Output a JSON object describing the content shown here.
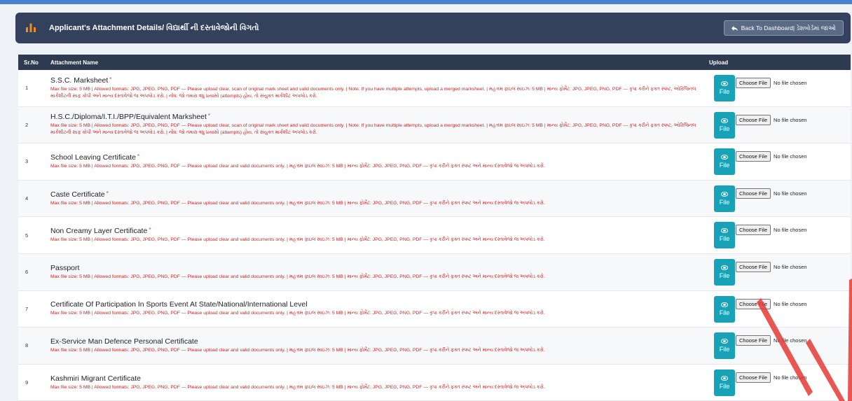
{
  "header": {
    "title": "Applicant's Attachment Details/ વિદ્યાર્થી ની દસ્તાવેજોની વિગતો",
    "back_label": "Back To Dashboard| ડેશબોર્ડમાં જાઓ"
  },
  "table": {
    "headers": {
      "sr": "Sr.No",
      "name": "Attachment Name",
      "upload": "Upload"
    },
    "file_button_label": "File",
    "choose_label": "Choose File",
    "no_file_label": "No file chosen",
    "rows": [
      {
        "sr": "1",
        "name": "S.S.C. Marksheet",
        "required": "*",
        "desc": "Max file size: 5 MB | Allowed formats: JPG, JPEG, PNG, PDF — Please upload clear, scan of original mark sheet and valid documents only. | Note: If you have multiple attempts, upload a merged marksheet. | મહત્તમ ફાઇલ સાઇઝ: 5 MB | માન્ય ફોર્મેટ: JPG, JPEG, PNG, PDF — કૃપા કરીને ફક્ત સ્પષ્ટ, ઓરિજિનલ માર્કશીટની સાફ કોપી અને માન્ય દસ્તાવેજો જ અપલોડ કરો. | નોંધ: જો તમારા વધુ પ્રયાસો (attempts) હોય, તો સંયુક્ત માર્કશીટ અપલોડ કરો."
      },
      {
        "sr": "2",
        "name": "H.S.C./Diploma/I.T.I./BPP/Equivalent Marksheet",
        "required": "*",
        "desc": "Max file size: 5 MB | Allowed formats: JPG, JPEG, PNG, PDF — Please upload clear, scan of original mark sheet and valid documents only. | Note: If you have multiple attempts, upload a merged marksheet. | મહત્તમ ફાઇલ સાઇઝ: 5 MB | માન્ય ફોર્મેટ: JPG, JPEG, PNG, PDF — કૃપા કરીને ફક્ત સ્પષ્ટ, ઓરિજિનલ માર્કશીટની સાફ કોપી અને માન્ય દસ્તાવેજો જ અપલોડ કરો. | નોંધ: જો તમારા વધુ પ્રયાસો (attempts) હોય, તો સંયુક્ત માર્કશીટ અપલોડ કરો."
      },
      {
        "sr": "3",
        "name": "School Leaving Certificate",
        "required": "*",
        "desc": "Max file size: 5 MB | Allowed formats: JPG, JPEG, PNG, PDF — Please upload clear and valid documents only. | મહત્તમ ફાઇલ સાઇઝ: 5 MB | માન્ય ફોર્મેટ: JPG, JPEG, PNG, PDF — કૃપા કરીને ફક્ત સ્પષ્ટ અને માન્ય દસ્તાવેજો જ અપલોડ કરો."
      },
      {
        "sr": "4",
        "name": "Caste Certificate",
        "required": "*",
        "desc": "Max file size: 5 MB | Allowed formats: JPG, JPEG, PNG, PDF — Please upload clear and valid documents only. | મહત્તમ ફાઇલ સાઇઝ: 5 MB | માન્ય ફોર્મેટ: JPG, JPEG, PNG, PDF — કૃપા કરીને ફક્ત સ્પષ્ટ અને માન્ય દસ્તાવેજો જ અપલોડ કરો."
      },
      {
        "sr": "5",
        "name": "Non Creamy Layer Certificate",
        "required": "*",
        "desc": "Max file size: 5 MB | Allowed formats: JPG, JPEG, PNG, PDF — Please upload clear and valid documents only. | મહત્તમ ફાઇલ સાઇઝ: 5 MB | માન્ય ફોર્મેટ: JPG, JPEG, PNG, PDF — કૃપા કરીને ફક્ત સ્પષ્ટ અને માન્ય દસ્તાવેજો જ અપલોડ કરો."
      },
      {
        "sr": "6",
        "name": "Passport",
        "required": "",
        "desc": "Max file size: 5 MB | Allowed formats: JPG, JPEG, PNG, PDF — Please upload clear and valid documents only. | મહત્તમ ફાઇલ સાઇઝ: 5 MB | માન્ય ફોર્મેટ: JPG, JPEG, PNG, PDF — કૃપા કરીને ફક્ત સ્પષ્ટ અને માન્ય દસ્તાવેજો જ અપલોડ કરો."
      },
      {
        "sr": "7",
        "name": "Certificate Of Participation In Sports Event At State/National/International Level",
        "required": "",
        "desc": "Max file size: 5 MB | Allowed formats: JPG, JPEG, PNG, PDF — Please upload clear and valid documents only. | મહત્તમ ફાઇલ સાઇઝ: 5 MB | માન્ય ફોર્મેટ: JPG, JPEG, PNG, PDF — કૃપા કરીને ફક્ત સ્પષ્ટ અને માન્ય દસ્તાવેજો જ અપલોડ કરો."
      },
      {
        "sr": "8",
        "name": "Ex-Service Man Defence Personal Certificate",
        "required": "",
        "desc": "Max file size: 5 MB | Allowed formats: JPG, JPEG, PNG, PDF — Please upload clear and valid documents only. | મહત્તમ ફાઇલ સાઇઝ: 5 MB | માન્ય ફોર્મેટ: JPG, JPEG, PNG, PDF — કૃપા કરીને ફક્ત સ્પષ્ટ અને માન્ય દસ્તાવેજો જ અપલોડ કરો."
      },
      {
        "sr": "9",
        "name": "Kashmiri Migrant Certificate",
        "required": "",
        "desc": "Max file size: 5 MB | Allowed formats: JPG, JPEG, PNG, PDF — Please upload clear and valid documents only. | મહત્તમ ફાઇલ સાઇઝ: 5 MB | માન્ય ફોર્મેટ: JPG, JPEG, PNG, PDF — કૃપા કરીને ફક્ત સ્પષ્ટ અને માન્ય દસ્તાવેજો જ અપલોડ કરો."
      }
    ]
  },
  "colors": {
    "header_bg": "#34415c",
    "table_head_bg": "#2e3a4f",
    "file_button": "#17a2b8",
    "desc_text": "#c62828",
    "annotation": "#e53935"
  },
  "icons": {
    "logo": "graduate-icon",
    "back": "back-arrow-icon",
    "file": "eye-icon"
  }
}
